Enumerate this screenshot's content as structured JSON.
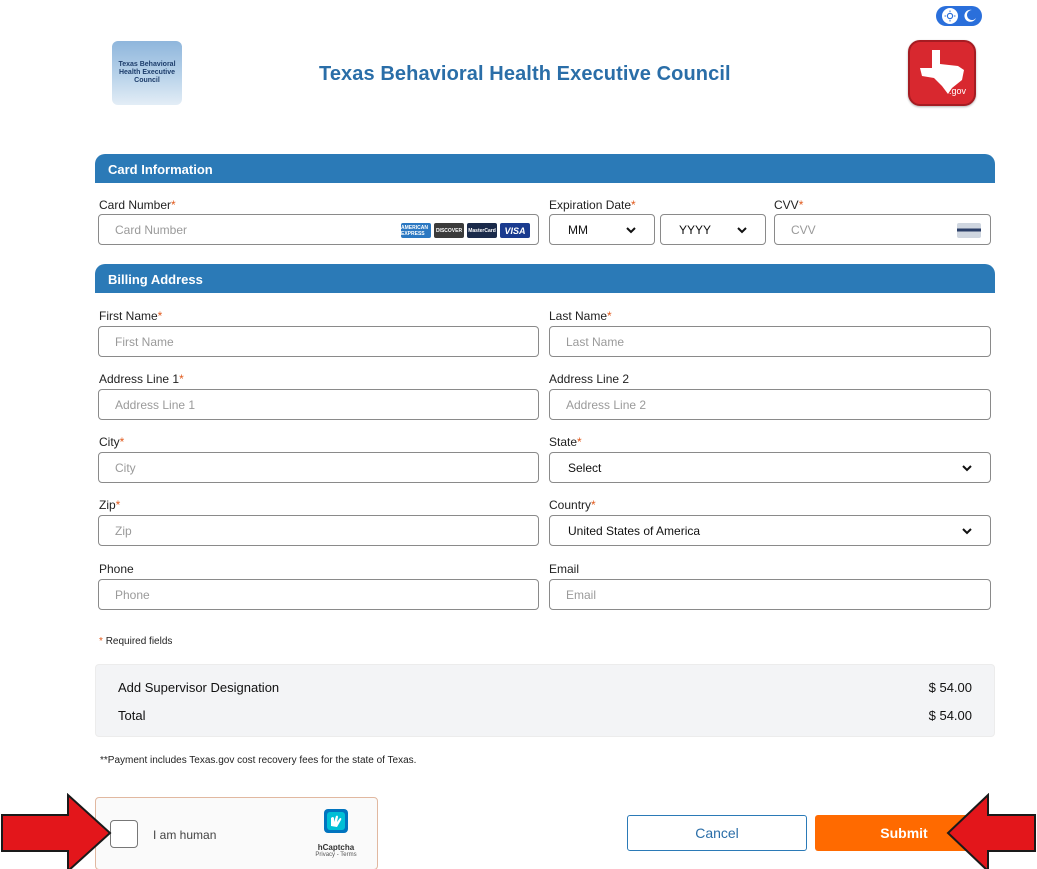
{
  "header": {
    "site_title": "Texas Behavioral Health Executive Council",
    "left_logo_text": "Texas Behavioral Health Executive Council",
    "right_logo_text": ".gov"
  },
  "card_section": {
    "title": "Card Information",
    "card_number": {
      "label": "Card Number",
      "placeholder": "Card Number"
    },
    "card_brands": [
      "AMERICAN EXPRESS",
      "DISCOVER",
      "MasterCard",
      "VISA"
    ],
    "expiration": {
      "label": "Expiration Date",
      "month": "MM",
      "year": "YYYY"
    },
    "cvv": {
      "label": "CVV",
      "placeholder": "CVV"
    }
  },
  "billing_section": {
    "title": "Billing Address",
    "first_name": {
      "label": "First Name",
      "placeholder": "First Name"
    },
    "last_name": {
      "label": "Last Name",
      "placeholder": "Last Name"
    },
    "address1": {
      "label": "Address Line 1",
      "placeholder": "Address Line 1"
    },
    "address2": {
      "label": "Address Line 2",
      "placeholder": "Address Line 2"
    },
    "city": {
      "label": "City",
      "placeholder": "City"
    },
    "state": {
      "label": "State",
      "value": "Select"
    },
    "zip": {
      "label": "Zip",
      "placeholder": "Zip"
    },
    "country": {
      "label": "Country",
      "value": "United States of America"
    },
    "phone": {
      "label": "Phone",
      "placeholder": "Phone"
    },
    "email": {
      "label": "Email",
      "placeholder": "Email"
    }
  },
  "required_star": "*",
  "required_note": "Required fields",
  "summary": {
    "items": [
      {
        "label": "Add Supervisor Designation",
        "amount": "$ 54.00"
      },
      {
        "label": "Total",
        "amount": "$ 54.00"
      }
    ]
  },
  "fee_note": "**Payment includes Texas.gov cost recovery fees for the state of Texas.",
  "captcha": {
    "label": "I am human",
    "brand": "hCaptcha",
    "links": "Privacy - Terms"
  },
  "buttons": {
    "cancel": "Cancel",
    "submit": "Submit"
  },
  "colors": {
    "accent": "#2b7ab7",
    "submit": "#ff6a00",
    "required": "#e15a1d",
    "arrow": "#e3161b"
  }
}
